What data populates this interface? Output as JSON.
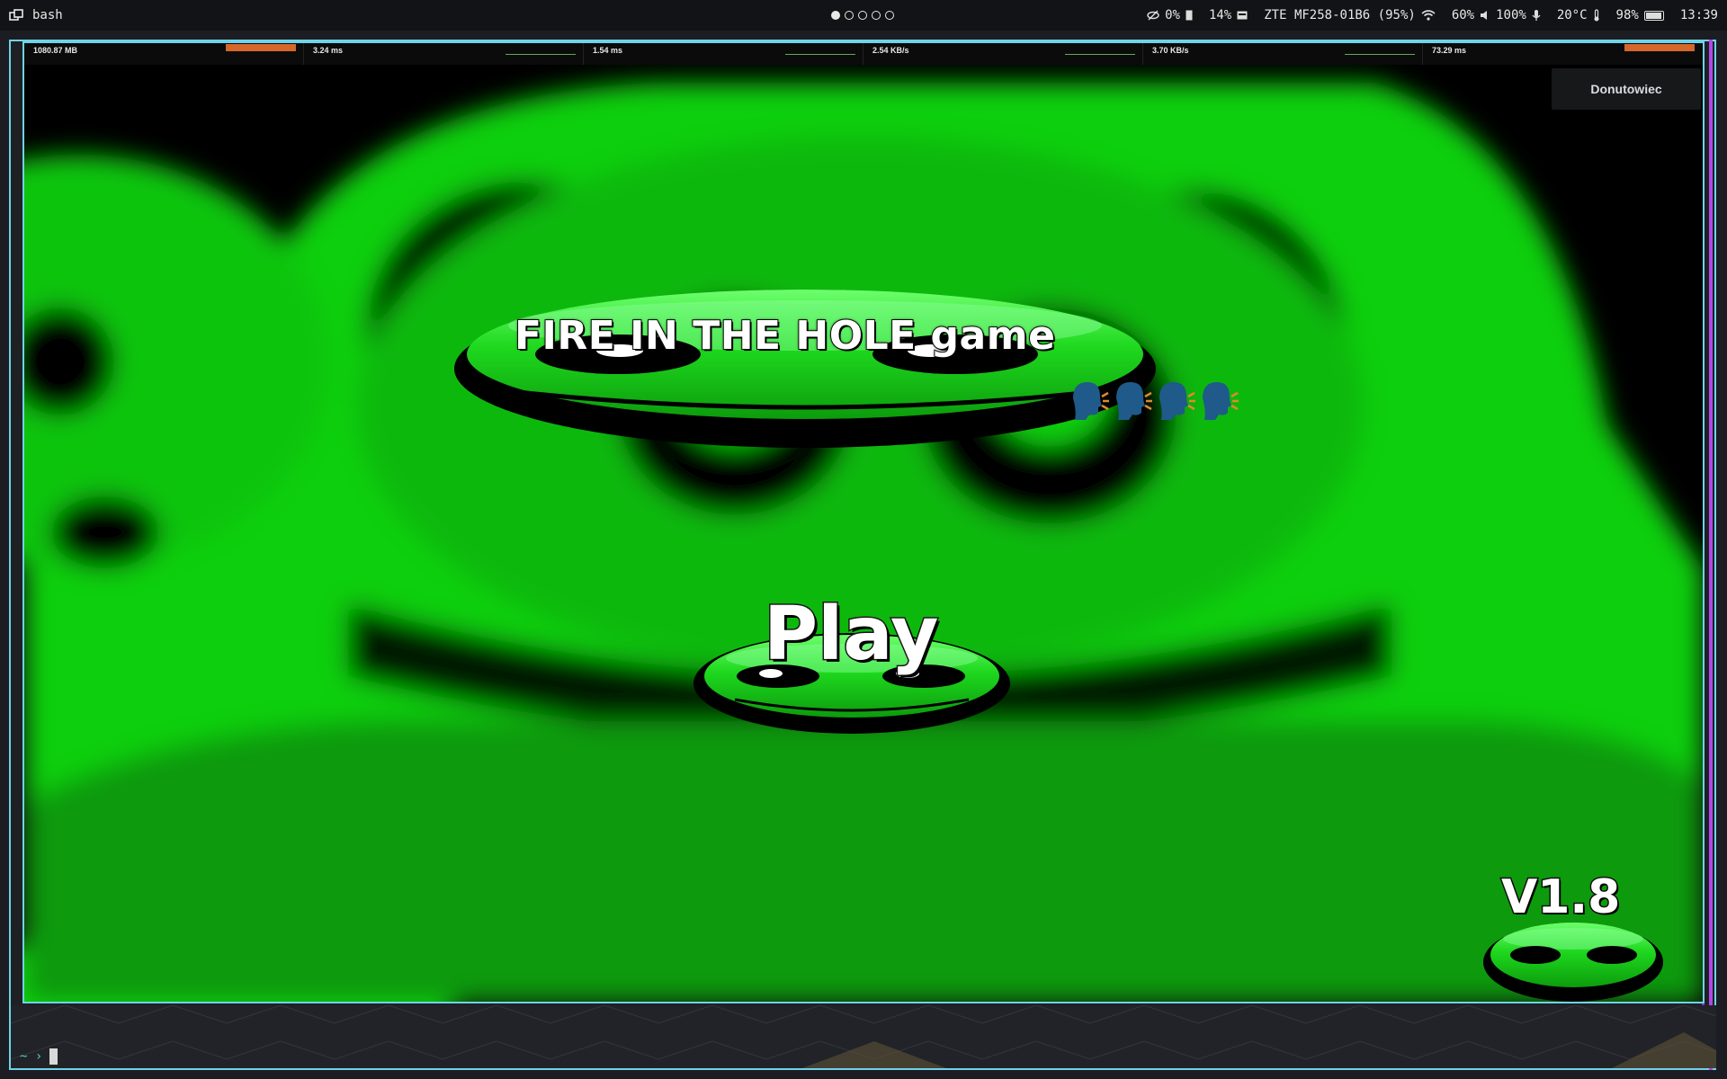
{
  "topbar": {
    "app_name": "bash",
    "workspaces": [
      true,
      false,
      false,
      false,
      false
    ],
    "privacy_pct": "0%",
    "memory_pct": "14%",
    "wifi_name": "ZTE MF258-01B6 (95%)",
    "volume_pct": "60%",
    "mic_pct": "100%",
    "temperature": "20°C",
    "battery_pct": "98%",
    "clock": "13:39"
  },
  "perf": {
    "memory": "1080.87 MB",
    "frame_time": "3.24 ms",
    "cpu_time": "1.54 ms",
    "net_down": "2.54 KB/s",
    "net_up": "3.70 KB/s",
    "ping": "73.29 ms"
  },
  "game": {
    "title": "FIRE IN THE HOLE game",
    "emoji_name": "speaking-head-emoji",
    "emoji_count": 4,
    "play_label": "Play",
    "version": "V1.8",
    "username": "Donutowiec"
  },
  "terminal": {
    "prompt": "~ ›"
  },
  "colors": {
    "frame": "#6fd3e8",
    "accent_purple": "#b348e8",
    "game_green": "#22d622",
    "prompt": "#3fd9c0"
  }
}
